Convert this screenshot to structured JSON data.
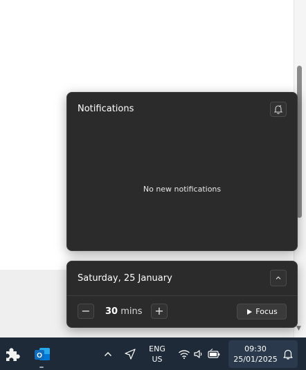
{
  "notifications": {
    "title": "Notifications",
    "empty_message": "No new notifications",
    "settings_icon": "notification-settings-icon"
  },
  "calendar": {
    "date_label": "Saturday, 25 January",
    "collapse_icon": "chevron-up-icon"
  },
  "focus": {
    "minus_label": "−",
    "value": "30",
    "unit": "mins",
    "plus_label": "+",
    "button_label": "Focus",
    "button_icon": "play-icon"
  },
  "taskbar": {
    "pinned": [
      {
        "name": "puzzle-app-icon"
      },
      {
        "name": "outlook-icon",
        "letter": "O"
      }
    ],
    "tray": {
      "overflow_icon": "chevron-up-icon",
      "location_icon": "location-icon",
      "lang_line1": "ENG",
      "lang_line2": "US",
      "wifi_icon": "wifi-icon",
      "volume_icon": "volume-icon",
      "battery_icon": "battery-icon"
    },
    "clock": {
      "time": "09:30",
      "date": "25/01/2025"
    },
    "bell_icon": "bell-icon"
  },
  "colors": {
    "panel_bg": "#2b2b2b",
    "taskbar_bg": "#1e2a38",
    "outlook_blue": "#0f6cbd"
  }
}
